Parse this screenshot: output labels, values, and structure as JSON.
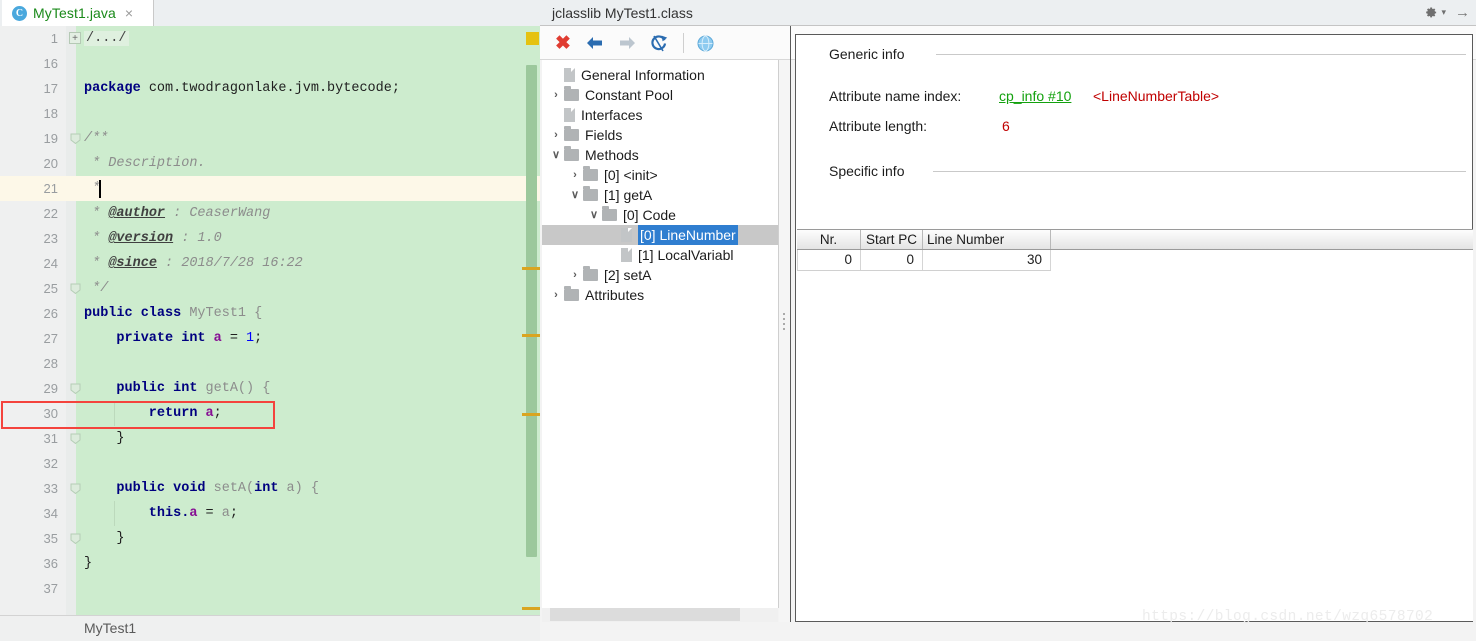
{
  "editor": {
    "tab": {
      "label": "MyTest1.java",
      "icon": "class-file-icon",
      "close": "×",
      "badge": "C"
    },
    "status_text": "MyTest1",
    "lines": [
      {
        "num": "1",
        "fold": "+",
        "tokens": [
          {
            "t": "/.../",
            "c": "foldbadge"
          }
        ]
      },
      {
        "num": "16",
        "fold": "",
        "tokens": []
      },
      {
        "num": "17",
        "fold": "",
        "tokens": [
          {
            "t": "package ",
            "c": "kw"
          },
          {
            "t": "com.twodragonlake.jvm.bytecode;",
            "c": "plain"
          }
        ]
      },
      {
        "num": "18",
        "fold": "",
        "tokens": []
      },
      {
        "num": "19",
        "fold": "-",
        "tokens": [
          {
            "t": "/**",
            "c": "cmt"
          }
        ]
      },
      {
        "num": "20",
        "fold": "",
        "tokens": [
          {
            "t": " * Description.",
            "c": "cmt"
          }
        ]
      },
      {
        "num": "21",
        "fold": "",
        "tokens": [
          {
            "t": " *",
            "c": "cmt"
          }
        ]
      },
      {
        "num": "22",
        "fold": "",
        "tokens": [
          {
            "t": " * ",
            "c": "cmt"
          },
          {
            "t": "@author",
            "c": "cmttag"
          },
          {
            "t": " : CeaserWang",
            "c": "cmt"
          }
        ]
      },
      {
        "num": "23",
        "fold": "",
        "tokens": [
          {
            "t": " * ",
            "c": "cmt"
          },
          {
            "t": "@version",
            "c": "cmttag"
          },
          {
            "t": " : 1.0",
            "c": "cmt"
          }
        ]
      },
      {
        "num": "24",
        "fold": "",
        "tokens": [
          {
            "t": " * ",
            "c": "cmt"
          },
          {
            "t": "@since",
            "c": "cmttag"
          },
          {
            "t": " : 2018/7/28 16:22",
            "c": "cmt"
          }
        ]
      },
      {
        "num": "25",
        "fold": "-",
        "tokens": [
          {
            "t": " */",
            "c": "cmt"
          }
        ]
      },
      {
        "num": "26",
        "fold": "",
        "tokens": [
          {
            "t": "public class ",
            "c": "kw"
          },
          {
            "t": "MyTest1 {",
            "c": "ident"
          }
        ]
      },
      {
        "num": "27",
        "fold": "",
        "tokens": [
          {
            "t": "    private int ",
            "c": "kw"
          },
          {
            "t": "a",
            "c": "fld"
          },
          {
            "t": " = ",
            "c": "plain"
          },
          {
            "t": "1",
            "c": "num"
          },
          {
            "t": ";",
            "c": "plain"
          }
        ]
      },
      {
        "num": "28",
        "fold": "",
        "tokens": []
      },
      {
        "num": "29",
        "fold": "-",
        "tokens": [
          {
            "t": "    public int ",
            "c": "kw"
          },
          {
            "t": "getA() {",
            "c": "ident"
          }
        ]
      },
      {
        "num": "30",
        "fold": "",
        "tokens": [
          {
            "t": "        return ",
            "c": "kw"
          },
          {
            "t": "a",
            "c": "fld"
          },
          {
            "t": ";",
            "c": "plain"
          }
        ]
      },
      {
        "num": "31",
        "fold": "-",
        "tokens": [
          {
            "t": "    }",
            "c": "plain"
          }
        ]
      },
      {
        "num": "32",
        "fold": "",
        "tokens": []
      },
      {
        "num": "33",
        "fold": "-",
        "tokens": [
          {
            "t": "    public void ",
            "c": "kw"
          },
          {
            "t": "setA(",
            "c": "ident"
          },
          {
            "t": "int ",
            "c": "kw"
          },
          {
            "t": "a) {",
            "c": "ident"
          }
        ]
      },
      {
        "num": "34",
        "fold": "",
        "tokens": [
          {
            "t": "        this.",
            "c": "kw"
          },
          {
            "t": "a",
            "c": "fld"
          },
          {
            "t": " = ",
            "c": "plain"
          },
          {
            "t": "a",
            "c": "ident"
          },
          {
            "t": ";",
            "c": "plain"
          }
        ]
      },
      {
        "num": "35",
        "fold": "-",
        "tokens": [
          {
            "t": "    }",
            "c": "plain"
          }
        ]
      },
      {
        "num": "36",
        "fold": "",
        "tokens": [
          {
            "t": "}",
            "c": "plain"
          }
        ]
      },
      {
        "num": "37",
        "fold": "",
        "tokens": []
      }
    ]
  },
  "jclasslib": {
    "tab_title": "jclasslib MyTest1.class",
    "gear_icon": "gear-icon",
    "gear_caret": "▾",
    "hide_icon": "→",
    "toolbar": [
      {
        "name": "close-button",
        "glyph": "✖",
        "color": "#e03c31"
      },
      {
        "name": "back-button",
        "glyph": "⇦",
        "color": "#2b6cb0"
      },
      {
        "name": "forward-button",
        "glyph": "⇨",
        "color": "#b9c3cc"
      },
      {
        "name": "reload-button",
        "glyph": "↺",
        "color": "#2b6cb0"
      },
      {
        "name": "browse-button",
        "glyph": "●",
        "color": "#6fb7e8"
      }
    ],
    "tree": [
      {
        "label": "General Information",
        "indent": 1,
        "twisty": "",
        "icon": "file-icon",
        "selected": false
      },
      {
        "label": "Constant Pool",
        "indent": 1,
        "twisty": "›",
        "icon": "folder-icon",
        "selected": false
      },
      {
        "label": "Interfaces",
        "indent": 1,
        "twisty": "",
        "icon": "file-icon",
        "selected": false
      },
      {
        "label": "Fields",
        "indent": 1,
        "twisty": "›",
        "icon": "folder-icon",
        "selected": false
      },
      {
        "label": "Methods",
        "indent": 1,
        "twisty": "∨",
        "icon": "folder-icon",
        "selected": false
      },
      {
        "label": "[0] <init>",
        "indent": 2,
        "twisty": "›",
        "icon": "folder-icon",
        "selected": false
      },
      {
        "label": "[1] getA",
        "indent": 2,
        "twisty": "∨",
        "icon": "folder-icon",
        "selected": false
      },
      {
        "label": "[0] Code",
        "indent": 3,
        "twisty": "∨",
        "icon": "folder-icon",
        "selected": false
      },
      {
        "label": "[0] LineNumber",
        "indent": 4,
        "twisty": "",
        "icon": "file-icon",
        "selected": true
      },
      {
        "label": "[1] LocalVariabl",
        "indent": 4,
        "twisty": "",
        "icon": "file-icon",
        "selected": false
      },
      {
        "label": "[2] setA",
        "indent": 2,
        "twisty": "›",
        "icon": "folder-icon",
        "selected": false
      },
      {
        "label": "Attributes",
        "indent": 1,
        "twisty": "›",
        "icon": "folder-icon",
        "selected": false
      }
    ],
    "detail": {
      "generic_title": "Generic info",
      "specific_title": "Specific info",
      "attribute_name_index_label": "Attribute name index:",
      "attribute_name_index_link": "cp_info #10",
      "attribute_name_index_value": "<LineNumberTable>",
      "attribute_length_label": "Attribute length:",
      "attribute_length_value": "6"
    },
    "table": {
      "columns": [
        "Nr.",
        "Start PC",
        "Line Number"
      ],
      "rows": [
        [
          "0",
          "0",
          "30"
        ]
      ]
    }
  },
  "watermark": "https://blog.csdn.net/wzq6578702",
  "colors": {
    "code_bg": "#cdecce",
    "highlight_row": "#fdf8e8",
    "red_box": "#f4433d",
    "tree_selection": "#2f7ed0",
    "link_green": "#13a10e",
    "value_red": "#c00000"
  }
}
